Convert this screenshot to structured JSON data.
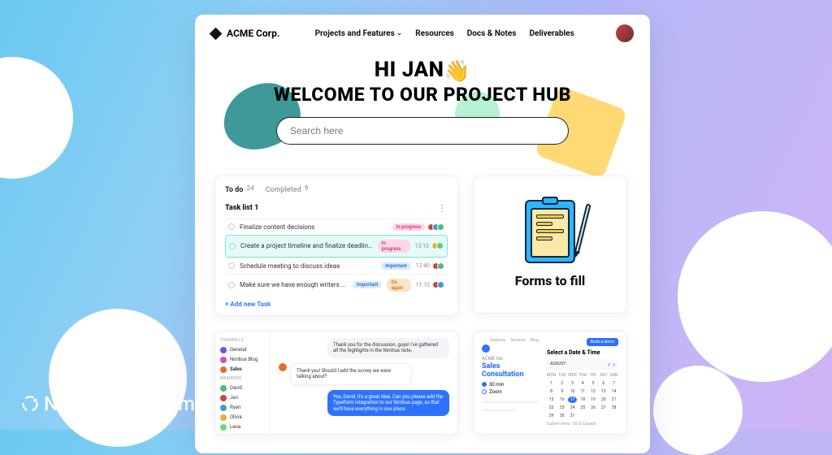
{
  "watermark": "Nimbus Platform™",
  "header": {
    "brand": "ACME Corp.",
    "nav": {
      "projects": "Projects and Features",
      "resources": "Resources",
      "docs": "Docs & Notes",
      "deliverables": "Deliverables"
    }
  },
  "hero": {
    "greeting": "HI JAN",
    "wave": "👋",
    "subtitle": "WELCOME TO OUR PROJECT HUB",
    "search_placeholder": "Search here"
  },
  "tasks": {
    "tabs": {
      "todo_label": "To do",
      "todo_count": "24",
      "completed_label": "Completed",
      "completed_count": "9"
    },
    "list_title": "Task list 1",
    "rows": [
      {
        "title": "Finalize content decisions",
        "badge1": "In progress",
        "time": ""
      },
      {
        "title": "Create a project timeline and finalize deadlines",
        "badge1": "In progress",
        "time": "13:10"
      },
      {
        "title": "Schedule meeting to discuss ideas",
        "badge1": "Important",
        "time": "12:40"
      },
      {
        "title": "Make sure we have enough writers for content",
        "badge1": "Important",
        "badge2": "Do again",
        "time": "11:15"
      }
    ],
    "add_label": "+  Add new Task"
  },
  "forms": {
    "title": "Forms to fill"
  },
  "chat": {
    "sections": {
      "channels": "CHANNELS",
      "members": "MEMBERS"
    },
    "channels": [
      "General",
      "Nimbus Blog",
      "Sales"
    ],
    "members": [
      "David",
      "Jan",
      "Ryan",
      "Olivia",
      "Lena"
    ],
    "messages": {
      "m1": "Thank you for the discussion, guys! I've gathered all the highlights in the Nimbus note.",
      "m2": "Thank you! Should I add the survey we were talking about?",
      "m3": "Yes, David, it's a great idea. Can you please add the Typeform integration to our Nimbus page, so that we'll have everything in one place."
    }
  },
  "booking": {
    "top_nav": {
      "features": "Features",
      "services": "Services",
      "blog": "Blog",
      "book": "Book a demo"
    },
    "company": "ACME Inc",
    "title": "Sales Consultation",
    "options": {
      "o1": "30 min",
      "o2": "Zoom"
    },
    "select_label": "Select a Date & Time",
    "month": "AUGUST",
    "weekdays": [
      "MON",
      "TUE",
      "WED",
      "THU",
      "FRI",
      "SAT",
      "SUN"
    ],
    "month_len": 31,
    "first_offset": 0,
    "today": 17,
    "timezone": "Eastern time - US & Canada"
  }
}
